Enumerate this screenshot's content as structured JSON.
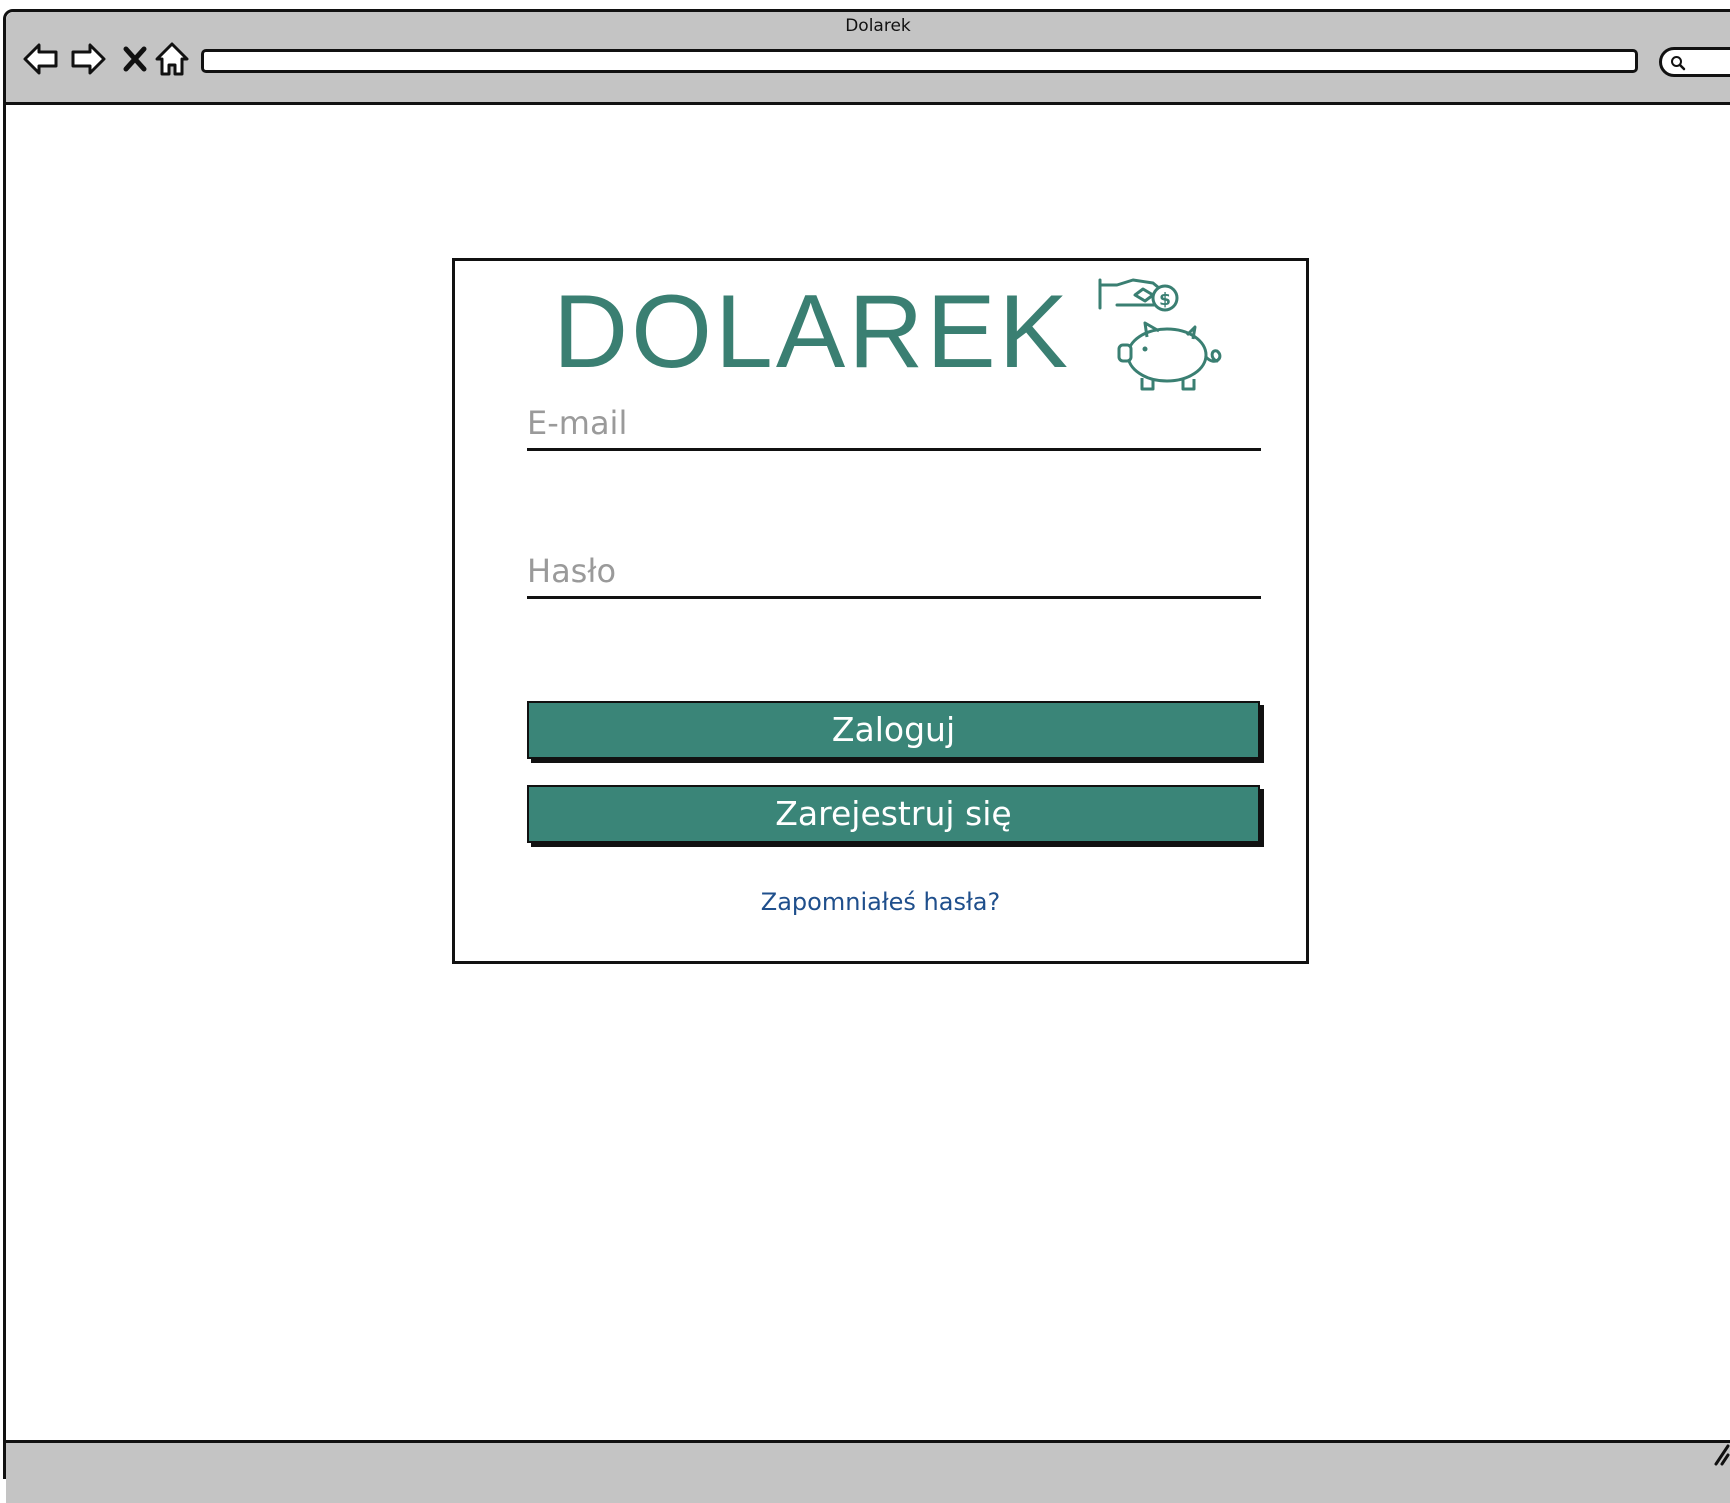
{
  "window": {
    "title": "Dolarek",
    "address_value": "",
    "icons": [
      "back-icon",
      "forward-icon",
      "stop-icon",
      "home-icon",
      "search-icon"
    ]
  },
  "login": {
    "logo_text": "DOLAREK",
    "email_placeholder": "E-mail",
    "password_placeholder": "Hasło",
    "login_button": "Zaloguj",
    "register_button": "Zarejestruj się",
    "forgot_link": "Zapomniałeś hasła?"
  },
  "colors": {
    "brand": "#3a7f72",
    "button": "#3a8578",
    "link": "#1f4f8c",
    "chrome": "#c4c4c4"
  }
}
